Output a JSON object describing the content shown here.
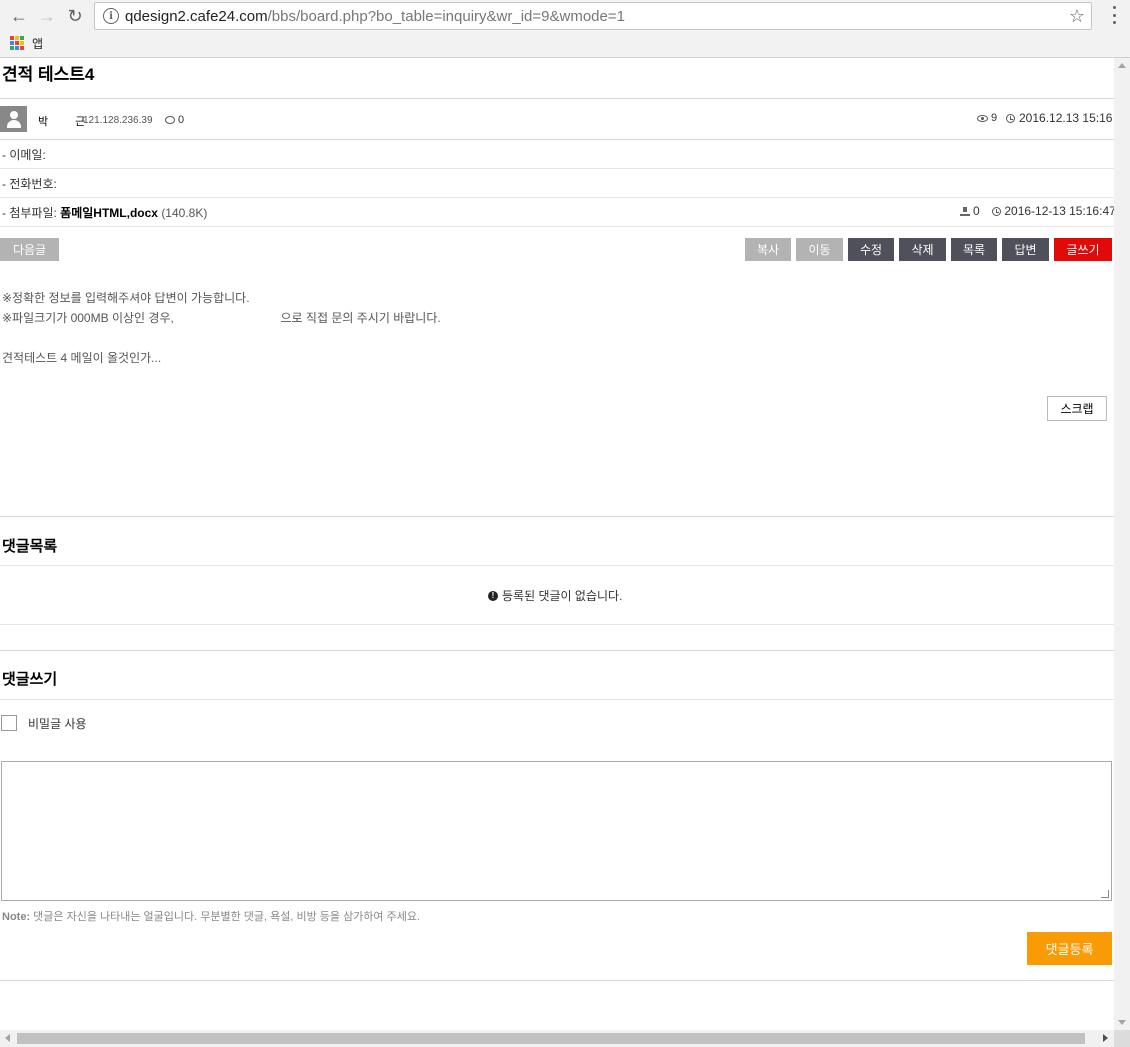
{
  "browser": {
    "back_icon": "arrow-left-icon",
    "forward_icon": "arrow-right-icon",
    "reload_icon": "reload-icon",
    "url_host": "qdesign2.cafe24.com",
    "url_path": "/bbs/board.php?bo_table=inquiry&wr_id=9&wmode=1",
    "bookmark_apps_label": "앱"
  },
  "post": {
    "title": "견적 테스트4",
    "author": "박 근",
    "ip": "121.128.236.39",
    "comment_count": "0",
    "views": "9",
    "date": "2016.12.13 15:16"
  },
  "info": {
    "email_label": "- 이메일:",
    "phone_label": "- 전화번호:",
    "attach_label": "- 첨부파일:",
    "attach_name": "폼메일HTML,docx",
    "attach_size": "(140.8K)",
    "download_count": "0",
    "attach_date": "2016-12-13 15:16:47"
  },
  "buttons": {
    "next": "다음글",
    "copy": "복사",
    "move": "이동",
    "edit": "수정",
    "delete": "삭제",
    "list": "목록",
    "reply": "답변",
    "write": "글쓰기",
    "scrap": "스크랩"
  },
  "content": {
    "notice1": "※정확한 정보를 입력해주셔야 답변이 가능합니다.",
    "notice2": "※파일크기가 000MB 이상인 경우,                                으로 직접 문의 주시기 바랍니다.",
    "body": "견적테스트 4 메일이 올것인가..."
  },
  "comments": {
    "list_title": "댓글목록",
    "empty_message": "등록된 댓글이 없습니다.",
    "write_title": "댓글쓰기",
    "secret_label": "비밀글 사용",
    "note_label": "Note:",
    "note_text": " 댓글은 자신을 나타내는 얼굴입니다. 무분별한 댓글, 욕설, 비방 등을 삼가하여 주세요.",
    "submit": "댓글등록"
  },
  "colors": {
    "accent_write": "#e10a0a",
    "accent_submit": "#f89b05",
    "button_dark": "#50505a",
    "button_gray": "#b3b3b3"
  }
}
